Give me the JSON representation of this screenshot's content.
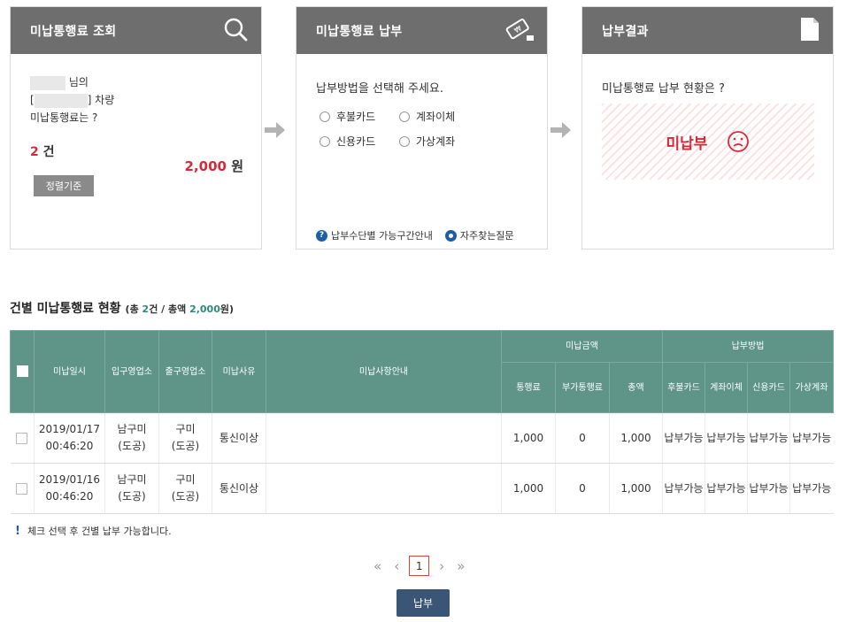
{
  "cards": {
    "inquiry": {
      "title": "미납통행료 조회",
      "icon": "search-icon",
      "name_suffix": "님의",
      "vehicle_open": "[",
      "vehicle_suffix": "] 차량",
      "question": "미납통행료는 ?",
      "count_value": "2",
      "count_unit": "건",
      "amount_value": "2,000",
      "amount_unit": "원",
      "button": "정렬기준"
    },
    "payment": {
      "title": "미납통행료 납부",
      "icon": "ticket-icon",
      "prompt": "납부방법을 선택해 주세요.",
      "options": [
        "후불카드",
        "계좌이체",
        "신용카드",
        "가상계좌"
      ],
      "link_guide": "납부수단별 가능구간안내",
      "link_faq": "자주찾는질문"
    },
    "result": {
      "title": "납부결과",
      "icon": "document-icon",
      "question": "미납통행료 납부 현황은 ?",
      "status": "미납부",
      "status_icon": "sad-face-icon"
    }
  },
  "colors": {
    "card_header": "#6e6e6e",
    "accent_red": "#d42a3c",
    "table_header": "#5f9488",
    "highlight_teal": "#2c8a7d",
    "pay_button": "#3b5576",
    "link_blue": "#1a5fa8"
  },
  "section": {
    "title": "건별 미납통행료 현황",
    "sub_open": "(총 ",
    "sub_count": "2",
    "sub_mid": "건 / 총액 ",
    "sub_amount": "2,000",
    "sub_close": "원)"
  },
  "table": {
    "headers": {
      "date": "미납일시",
      "entry": "입구영업소",
      "exit": "출구영업소",
      "reason": "미납사유",
      "guide": "미납사항안내",
      "amount_group": "미납금액",
      "toll": "통행료",
      "surcharge": "부가통행료",
      "total": "총액",
      "method_group": "납부방법",
      "m1": "후불카드",
      "m2": "계좌이체",
      "m3": "신용카드",
      "m4": "가상계좌"
    },
    "rows": [
      {
        "date": "2019/01/17",
        "time": "00:46:20",
        "entry": "남구미",
        "entry_sub": "(도공)",
        "exit": "구미",
        "exit_sub": "(도공)",
        "reason": "통신이상",
        "guide": "",
        "toll": "1,000",
        "surcharge": "0",
        "total": "1,000",
        "m1": "납부가능",
        "m2": "납부가능",
        "m3": "납부가능",
        "m4": "납부가능"
      },
      {
        "date": "2019/01/16",
        "time": "00:46:20",
        "entry": "남구미",
        "entry_sub": "(도공)",
        "exit": "구미",
        "exit_sub": "(도공)",
        "reason": "통신이상",
        "guide": "",
        "toll": "1,000",
        "surcharge": "0",
        "total": "1,000",
        "m1": "납부가능",
        "m2": "납부가능",
        "m3": "납부가능",
        "m4": "납부가능"
      }
    ]
  },
  "notice": {
    "mark": "!",
    "text": "체크 선택 후 건별 납부 가능합니다."
  },
  "pagination": {
    "first": "«",
    "prev": "‹",
    "current": "1",
    "next": "›",
    "last": "»"
  },
  "pay_button": "납부"
}
